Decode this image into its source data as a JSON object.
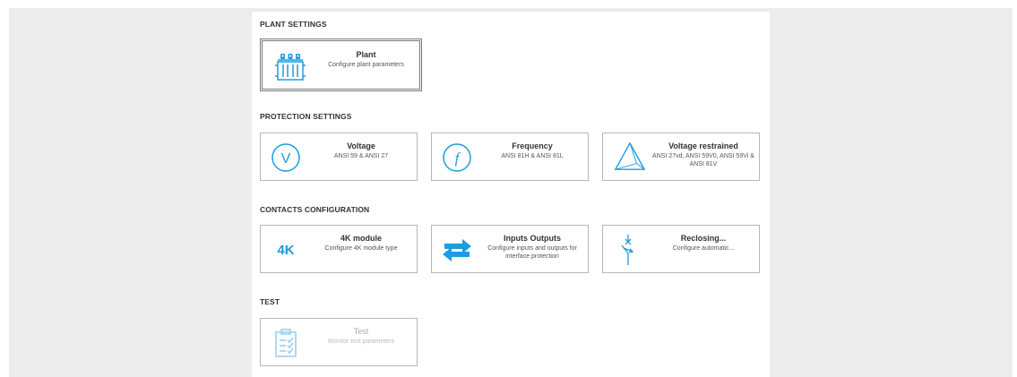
{
  "sections": {
    "plant": {
      "title": "PLANT SETTINGS",
      "tiles": [
        {
          "title": "Plant",
          "desc": "Configure plant parameters",
          "icon": "transformer-icon"
        }
      ]
    },
    "protection": {
      "title": "PROTECTION SETTINGS",
      "tiles": [
        {
          "title": "Voltage",
          "desc": "ANSI 59 & ANSI 27",
          "icon": "voltage-icon"
        },
        {
          "title": "Frequency",
          "desc": "ANSI 81H & ANSI 81L",
          "icon": "frequency-icon"
        },
        {
          "title": "Voltage restrained",
          "desc": "ANSI 27vd, ANSI 59V0, ANSI 59Vi & ANSI 81V",
          "icon": "triangle-icon"
        }
      ]
    },
    "contacts": {
      "title": "CONTACTS CONFIGURATION",
      "tiles": [
        {
          "title": "4K module",
          "desc": "Configure 4K module type",
          "icon_text": "4K"
        },
        {
          "title": "Inputs Outputs",
          "desc": "Configure inputs and outputs for interface protection",
          "icon": "swap-arrows-icon"
        },
        {
          "title": "Reclosing...",
          "desc": "Configure automatic...",
          "icon": "reclosing-icon"
        }
      ]
    },
    "test": {
      "title": "TEST",
      "tiles": [
        {
          "title": "Test",
          "desc": "Monitor test parameters",
          "icon": "clipboard-icon",
          "disabled": true
        }
      ]
    }
  },
  "colors": {
    "accent": "#1e9be2",
    "accent_disabled": "#9ccfee",
    "border": "#b7b7b7",
    "background": "#ececec"
  }
}
